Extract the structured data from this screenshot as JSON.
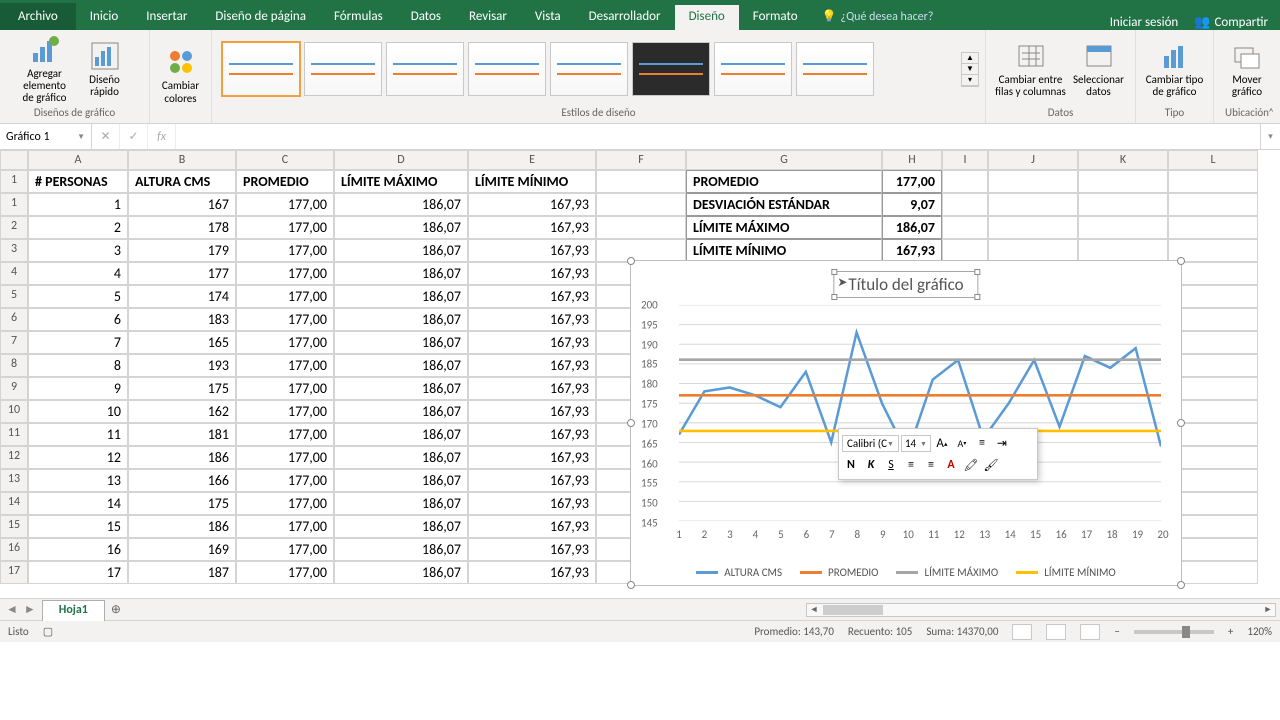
{
  "ribbon_tabs": {
    "file": "Archivo",
    "inicio": "Inicio",
    "insertar": "Insertar",
    "diseno_pagina": "Diseño de página",
    "formulas": "Fórmulas",
    "datos": "Datos",
    "revisar": "Revisar",
    "vista": "Vista",
    "desarrollador": "Desarrollador",
    "diseno": "Diseño",
    "formato": "Formato",
    "tell_me": "¿Qué desea hacer?",
    "login": "Iniciar sesión",
    "share": "Compartir"
  },
  "ribbon_groups": {
    "add_element": "Agregar elemento de gráfico",
    "quick_layout": "Diseño rápido",
    "change_colors": "Cambiar colores",
    "disenos": "Diseños de gráfico",
    "estilos": "Estilos de diseño",
    "switch_rc": "Cambiar entre filas y columnas",
    "select_data": "Seleccionar datos",
    "datos_lbl": "Datos",
    "change_type": "Cambiar tipo de gráfico",
    "tipo_lbl": "Tipo",
    "move_chart": "Mover gráfico",
    "ubicacion_lbl": "Ubicación"
  },
  "namebox": "Gráfico 1",
  "columns": [
    "A",
    "B",
    "C",
    "D",
    "E",
    "F",
    "G",
    "H",
    "I",
    "J",
    "K",
    "L"
  ],
  "headers": {
    "a": "# PERSONAS",
    "b": "ALTURA CMS",
    "c": "PROMEDIO",
    "d": "LÍMITE MÁXIMO",
    "e": "LÍMITE MÍNIMO"
  },
  "side": {
    "promedio_lbl": "PROMEDIO",
    "promedio_val": "177,00",
    "desv_lbl": "DESVIACIÓN ESTÁNDAR",
    "desv_val": "9,07",
    "lmax_lbl": "LÍMITE MÁXIMO",
    "lmax_val": "186,07",
    "lmin_lbl": "LÍMITE MÍNIMO",
    "lmin_val": "167,93"
  },
  "rows": [
    {
      "n": "1",
      "p": "1",
      "h": "167"
    },
    {
      "n": "2",
      "p": "2",
      "h": "178"
    },
    {
      "n": "3",
      "p": "3",
      "h": "179"
    },
    {
      "n": "4",
      "p": "4",
      "h": "177"
    },
    {
      "n": "5",
      "p": "5",
      "h": "174"
    },
    {
      "n": "6",
      "p": "6",
      "h": "183"
    },
    {
      "n": "7",
      "p": "7",
      "h": "165"
    },
    {
      "n": "8",
      "p": "8",
      "h": "193"
    },
    {
      "n": "9",
      "p": "9",
      "h": "175"
    },
    {
      "n": "10",
      "p": "10",
      "h": "162"
    },
    {
      "n": "11",
      "p": "11",
      "h": "181"
    },
    {
      "n": "12",
      "p": "12",
      "h": "186"
    },
    {
      "n": "13",
      "p": "13",
      "h": "166"
    },
    {
      "n": "14",
      "p": "14",
      "h": "175"
    },
    {
      "n": "15",
      "p": "15",
      "h": "186"
    },
    {
      "n": "16",
      "p": "16",
      "h": "169"
    },
    {
      "n": "17",
      "p": "17",
      "h": "187"
    }
  ],
  "const_vals": {
    "prom": "177,00",
    "lmax": "186,07",
    "lmin": "167,93"
  },
  "chart_title": "Título del gráfico",
  "mini_toolbar": {
    "font": "Calibri (C",
    "size": "14",
    "n": "N",
    "k": "K",
    "s": "S",
    "a_up": "A",
    "a_dn": "A"
  },
  "legend": {
    "s1": "ALTURA CMS",
    "s2": "PROMEDIO",
    "s3": "LÍMITE MÁXIMO",
    "s4": "LÍMITE MÍNIMO"
  },
  "sheet": "Hoja1",
  "status": {
    "ready": "Listo",
    "avg_lbl": "Promedio:",
    "avg": "143,70",
    "count_lbl": "Recuento:",
    "count": "105",
    "sum_lbl": "Suma:",
    "sum": "14370,00",
    "zoom": "120%"
  },
  "chart_data": {
    "type": "line",
    "title": "Título del gráfico",
    "x": [
      1,
      2,
      3,
      4,
      5,
      6,
      7,
      8,
      9,
      10,
      11,
      12,
      13,
      14,
      15,
      16,
      17,
      18,
      19,
      20
    ],
    "ylim": [
      145,
      200
    ],
    "yticks": [
      145,
      150,
      155,
      160,
      165,
      170,
      175,
      180,
      185,
      190,
      195,
      200
    ],
    "series": [
      {
        "name": "ALTURA CMS",
        "color": "#5b9bd5",
        "values": [
          167,
          178,
          179,
          177,
          174,
          183,
          165,
          193,
          175,
          162,
          181,
          186,
          166,
          175,
          186,
          169,
          187,
          184,
          189,
          164
        ]
      },
      {
        "name": "PROMEDIO",
        "color": "#ed7d31",
        "values": [
          177,
          177,
          177,
          177,
          177,
          177,
          177,
          177,
          177,
          177,
          177,
          177,
          177,
          177,
          177,
          177,
          177,
          177,
          177,
          177
        ]
      },
      {
        "name": "LÍMITE MÁXIMO",
        "color": "#a5a5a5",
        "values": [
          186.07,
          186.07,
          186.07,
          186.07,
          186.07,
          186.07,
          186.07,
          186.07,
          186.07,
          186.07,
          186.07,
          186.07,
          186.07,
          186.07,
          186.07,
          186.07,
          186.07,
          186.07,
          186.07,
          186.07
        ]
      },
      {
        "name": "LÍMITE MÍNIMO",
        "color": "#ffc000",
        "values": [
          167.93,
          167.93,
          167.93,
          167.93,
          167.93,
          167.93,
          167.93,
          167.93,
          167.93,
          167.93,
          167.93,
          167.93,
          167.93,
          167.93,
          167.93,
          167.93,
          167.93,
          167.93,
          167.93,
          167.93
        ]
      }
    ]
  }
}
